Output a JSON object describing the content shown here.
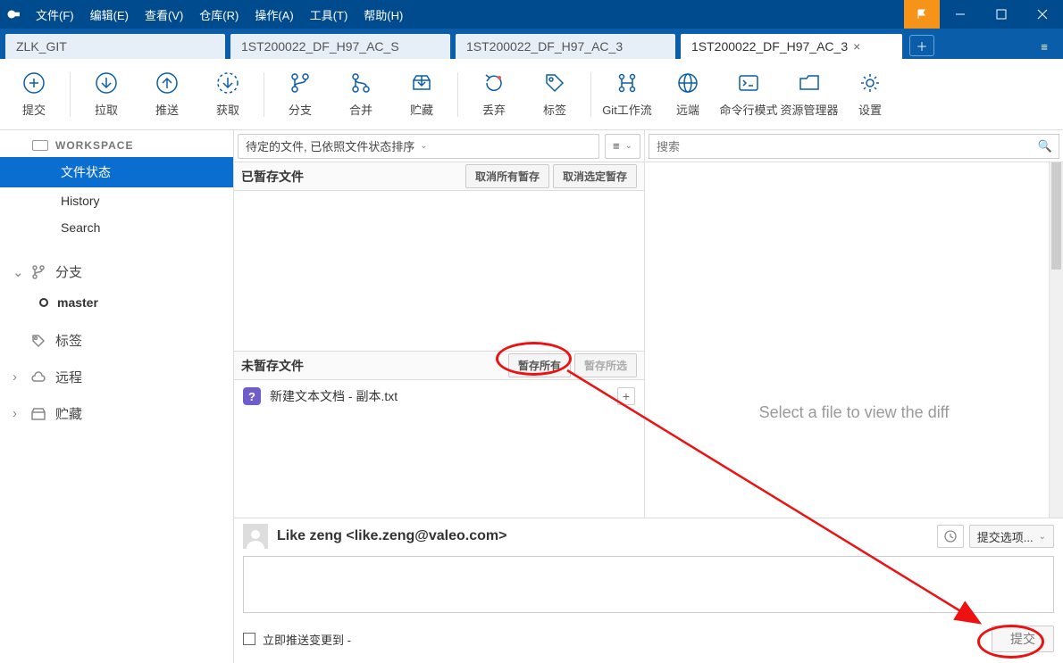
{
  "menu": {
    "file": "文件(F)",
    "edit": "编辑(E)",
    "view": "查看(V)",
    "repo": "仓库(R)",
    "action": "操作(A)",
    "tools": "工具(T)",
    "help": "帮助(H)"
  },
  "tabs": [
    "ZLK_GIT",
    "1ST200022_DF_H97_AC_S",
    "1ST200022_DF_H97_AC_3",
    "1ST200022_DF_H97_AC_3"
  ],
  "toolbar": {
    "commit": "提交",
    "pull": "拉取",
    "push": "推送",
    "fetch": "获取",
    "branch": "分支",
    "merge": "合并",
    "stash": "贮藏",
    "discard": "丢弃",
    "tag": "标签",
    "gitflow": "Git工作流",
    "remote": "远端",
    "cmd": "命令行模式",
    "explorer": "资源管理器",
    "settings": "设置"
  },
  "sidebar": {
    "workspace": "WORKSPACE",
    "items": {
      "status": "文件状态",
      "history": "History",
      "search": "Search"
    },
    "branch": "分支",
    "branchItem": "master",
    "tags": "标签",
    "remotes": "远程",
    "stashes": "贮藏"
  },
  "center": {
    "sortLabel": "待定的文件, 已依照文件状态排序",
    "stagedHeader": "已暂存文件",
    "unstageAll": "取消所有暂存",
    "unstageSelected": "取消选定暂存",
    "unstagedHeader": "未暂存文件",
    "stageAll": "暂存所有",
    "stageSelected": "暂存所选",
    "file": "新建文本文档 - 副本.txt"
  },
  "right": {
    "searchPlaceholder": "搜索",
    "diffPlaceholder": "Select a file to view the diff"
  },
  "commit": {
    "author": "Like zeng <like.zeng@valeo.com>",
    "options": "提交选项...",
    "push": "立即推送变更到 -",
    "button": "提交"
  }
}
